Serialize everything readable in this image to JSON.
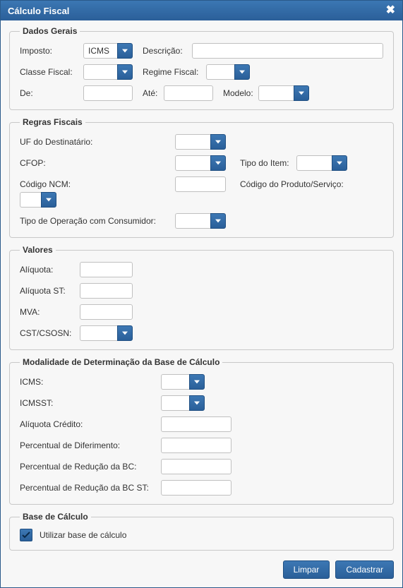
{
  "window": {
    "title": "Cálculo Fiscal"
  },
  "dados": {
    "legend": "Dados Gerais",
    "imposto_label": "Imposto:",
    "imposto_value": "ICMS",
    "descricao_label": "Descrição:",
    "descricao_value": "",
    "classe_label": "Classe Fiscal:",
    "classe_value": "",
    "regime_label": "Regime Fiscal:",
    "regime_value": "",
    "de_label": "De:",
    "de_value": "",
    "ate_label": "Até:",
    "ate_value": "",
    "modelo_label": "Modelo:",
    "modelo_value": ""
  },
  "regras": {
    "legend": "Regras Fiscais",
    "uf_label": "UF do Destinatário:",
    "uf_value": "",
    "cfop_label": "CFOP:",
    "cfop_value": "",
    "tipoitem_label": "Tipo do Item:",
    "tipoitem_value": "",
    "ncm_label": "Código NCM:",
    "ncm_value": "",
    "prodserv_label": "Código do Produto/Serviço:",
    "prodserv_value": "",
    "tipoop_label": "Tipo de Operação com Consumidor:",
    "tipoop_value": ""
  },
  "valores": {
    "legend": "Valores",
    "aliquota_label": "Alíquota:",
    "aliquota_value": "",
    "aliquotast_label": "Alíquota ST:",
    "aliquotast_value": "",
    "mva_label": "MVA:",
    "mva_value": "",
    "cst_label": "CST/CSOSN:",
    "cst_value": ""
  },
  "modalidade": {
    "legend": "Modalidade de Determinação da Base de Cálculo",
    "icms_label": "ICMS:",
    "icms_value": "",
    "icmsst_label": "ICMSST:",
    "icmsst_value": "",
    "aliqcred_label": "Alíquota Crédito:",
    "aliqcred_value": "",
    "percdif_label": "Percentual de Diferimento:",
    "percdif_value": "",
    "percredbc_label": "Percentual de Redução da BC:",
    "percredbc_value": "",
    "percredbcst_label": "Percentual de Redução da BC ST:",
    "percredbcst_value": ""
  },
  "base": {
    "legend": "Base de Cálculo",
    "utilizar_label": "Utilizar base de cálculo",
    "utilizar_checked": true
  },
  "footer": {
    "limpar": "Limpar",
    "cadastrar": "Cadastrar"
  }
}
